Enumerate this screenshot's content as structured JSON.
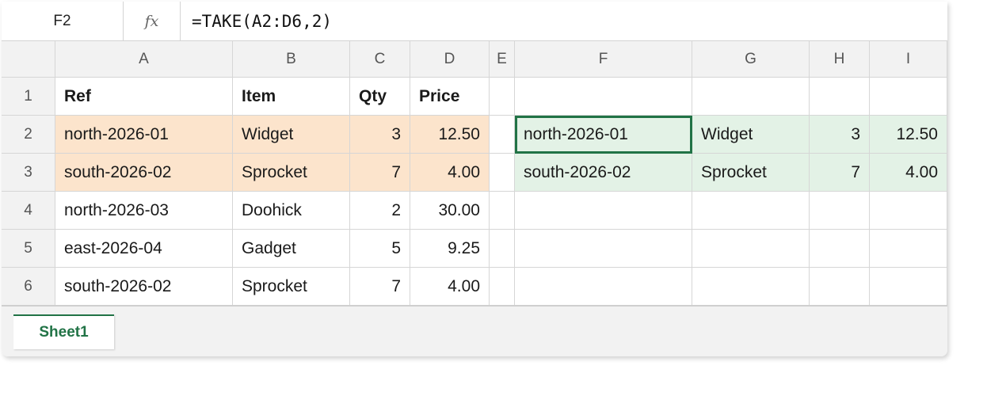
{
  "formula_bar": {
    "name_box": "F2",
    "fx_label": "fx",
    "formula": "=TAKE(A2:D6,2)"
  },
  "columns": [
    "A",
    "B",
    "C",
    "D",
    "E",
    "F",
    "G",
    "H",
    "I"
  ],
  "rows": [
    "1",
    "2",
    "3",
    "4",
    "5",
    "6"
  ],
  "cells": {
    "A1": "Ref",
    "B1": "Item",
    "C1": "Qty",
    "D1": "Price",
    "A2": "north-2026-01",
    "B2": "Widget",
    "C2": "3",
    "D2": "12.50",
    "A3": "south-2026-02",
    "B3": "Sprocket",
    "C3": "7",
    "D3": "4.00",
    "A4": "north-2026-03",
    "B4": "Doohick",
    "C4": "2",
    "D4": "30.00",
    "A5": "east-2026-04",
    "B5": "Gadget",
    "C5": "5",
    "D5": "9.25",
    "A6": "south-2026-02",
    "B6": "Sprocket",
    "C6": "7",
    "D6": "4.00",
    "F2": "north-2026-01",
    "G2": "Widget",
    "H2": "3",
    "I2": "12.50",
    "F3": "south-2026-02",
    "G3": "Sprocket",
    "H3": "7",
    "I3": "4.00"
  },
  "sheet_tabs": [
    "Sheet1"
  ],
  "colors": {
    "source_fill": "#fce4cc",
    "result_fill": "#e3f2e6",
    "accent": "#217346"
  },
  "active_cell": "F2"
}
